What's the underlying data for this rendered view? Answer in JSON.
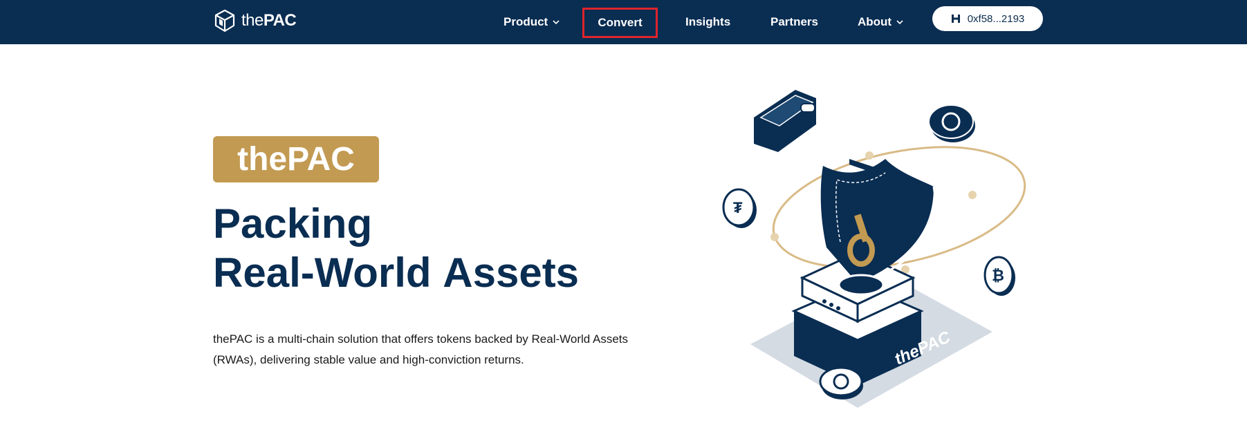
{
  "brand": {
    "the": "the",
    "pac": "PAC"
  },
  "nav": {
    "product": "Product",
    "convert": "Convert",
    "insights": "Insights",
    "partners": "Partners",
    "about": "About"
  },
  "wallet": {
    "address": "0xf58...2193"
  },
  "hero": {
    "badge": "thePAC",
    "headline_line1": "Packing",
    "headline_line2_prefix": "Real-World ",
    "headline_line2_accent": "Assets",
    "description": "thePAC is a multi-chain solution that offers tokens backed by Real-World Assets (RWAs), delivering stable value and high-conviction returns.",
    "illustration_label": "thePAC"
  },
  "colors": {
    "navy": "#0a2d52",
    "gold": "#c29a52",
    "highlight_border": "#e0242b",
    "white": "#ffffff"
  },
  "icons": {
    "logo": "cube-logo-icon",
    "chevron": "chevron-down-icon",
    "wallet": "wallet-chain-icon"
  }
}
